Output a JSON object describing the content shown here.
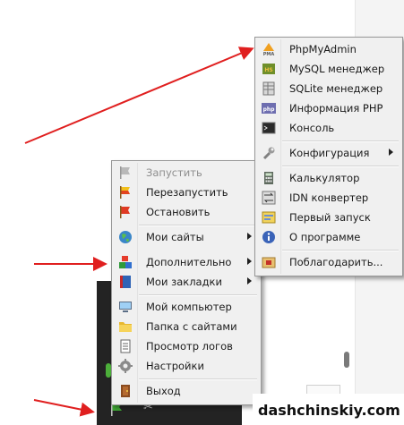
{
  "main_menu": {
    "items": [
      {
        "label": "Запустить",
        "icon": "flag-gray-icon",
        "disabled": true
      },
      {
        "label": "Перезапустить",
        "icon": "flag-yellow-red-icon"
      },
      {
        "label": "Остановить",
        "icon": "flag-red-icon"
      },
      {
        "label": "Мои сайты",
        "icon": "globe-icon",
        "submenu": true
      },
      {
        "label": "Дополнительно",
        "icon": "blocks-icon",
        "submenu": true
      },
      {
        "label": "Мои закладки",
        "icon": "book-icon",
        "submenu": true
      },
      {
        "label": "Мой компьютер",
        "icon": "computer-icon"
      },
      {
        "label": "Папка с сайтами",
        "icon": "folder-icon"
      },
      {
        "label": "Просмотр логов",
        "icon": "document-icon"
      },
      {
        "label": "Настройки",
        "icon": "gear-icon"
      },
      {
        "label": "Выход",
        "icon": "door-icon"
      }
    ]
  },
  "sub_menu": {
    "items": [
      {
        "label": "PhpMyAdmin",
        "icon": "pma-icon"
      },
      {
        "label": "MySQL менеджер",
        "icon": "mysql-icon"
      },
      {
        "label": "SQLite менеджер",
        "icon": "sqlite-icon"
      },
      {
        "label": "Информация PHP",
        "icon": "php-icon"
      },
      {
        "label": "Консоль",
        "icon": "console-icon"
      },
      {
        "label": "Конфигурация",
        "icon": "wrench-icon",
        "submenu": true
      },
      {
        "label": "Калькулятор",
        "icon": "calculator-icon"
      },
      {
        "label": "IDN конвертер",
        "icon": "idn-icon"
      },
      {
        "label": "Первый запуск",
        "icon": "first-run-icon"
      },
      {
        "label": "О программе",
        "icon": "info-icon"
      },
      {
        "label": "Поблагодарить...",
        "icon": "thanks-icon"
      }
    ]
  },
  "tray": {
    "scissors_glyph": "✂"
  },
  "watermark": "dashchinskiy.com",
  "colors": {
    "arrow": "#e01f1f",
    "menu_bg": "#f0f0f0",
    "menu_border": "#979797"
  }
}
